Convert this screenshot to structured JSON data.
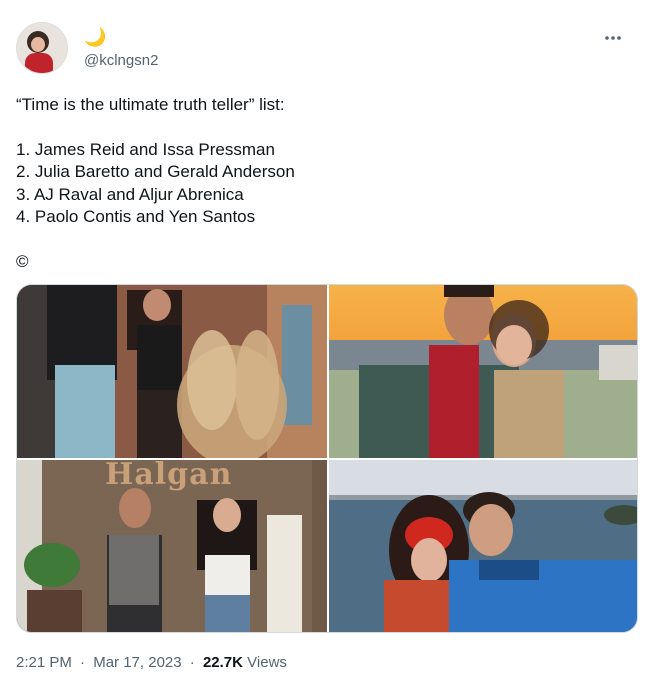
{
  "author": {
    "display_name_emoji": "🌙",
    "handle": "@kclngsn2"
  },
  "more_icon": "more-horizontal-icon",
  "tweet": {
    "lines": [
      "“Time is the ultimate truth teller” list:",
      "1. James Reid and Issa Pressman",
      "2. Julia Baretto and Gerald Anderson",
      "3. AJ Raval and Aljur Abrenica",
      "4. Paolo Contis and Yen Santos",
      "©"
    ]
  },
  "media": {
    "photos": [
      {
        "description": "couple-photo-1"
      },
      {
        "description": "couple-photo-2"
      },
      {
        "description": "couple-photo-3"
      },
      {
        "description": "couple-photo-4"
      }
    ],
    "sign_text": "Halgan"
  },
  "meta": {
    "time": "2:21 PM",
    "separator": "·",
    "date": "Mar 17, 2023",
    "views_count": "22.7K",
    "views_label": "Views"
  },
  "colors": {
    "text": "#0f1419",
    "secondary": "#536471",
    "border": "#cfd9de"
  }
}
